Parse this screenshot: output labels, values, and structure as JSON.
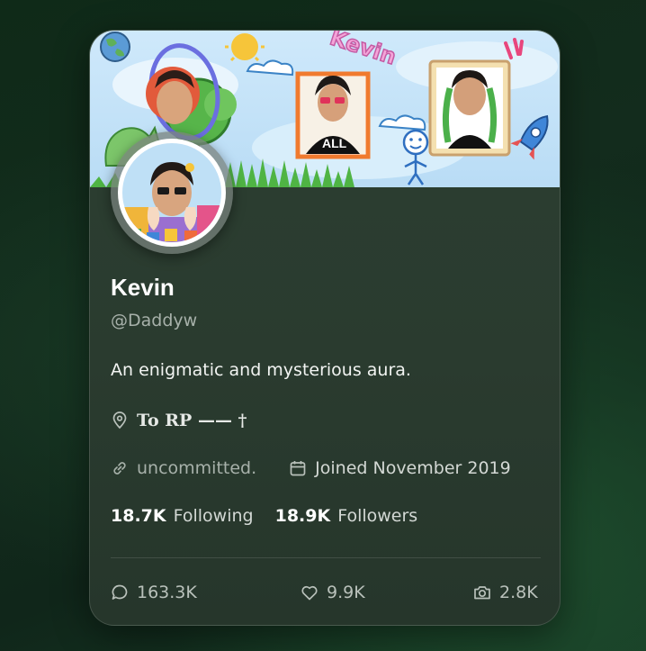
{
  "profile": {
    "name": "Kevin",
    "handle": "@Daddyw",
    "bio": "An enigmatic and mysterious aura.",
    "location": "To RP —— †",
    "website": "uncommitted.",
    "joined": "Joined November 2019"
  },
  "banner": {
    "doodle_text": "Kevin"
  },
  "stats": {
    "following_count": "18.7K",
    "following_label": "Following",
    "followers_count": "18.9K",
    "followers_label": "Followers"
  },
  "counters": {
    "replies": "163.3K",
    "likes": "9.9K",
    "media": "2.8K"
  },
  "icons": {
    "location": "map-pin-icon",
    "website": "link-icon",
    "joined": "calendar-icon",
    "replies": "speech-bubble-icon",
    "likes": "heart-icon",
    "media": "camera-icon"
  },
  "colors": {
    "card_background": "#2a3b2f",
    "page_background": "#10261a",
    "banner_sky": "#c6e4f8",
    "text_primary": "#ffffff",
    "text_secondary": "#a7b1aa"
  }
}
